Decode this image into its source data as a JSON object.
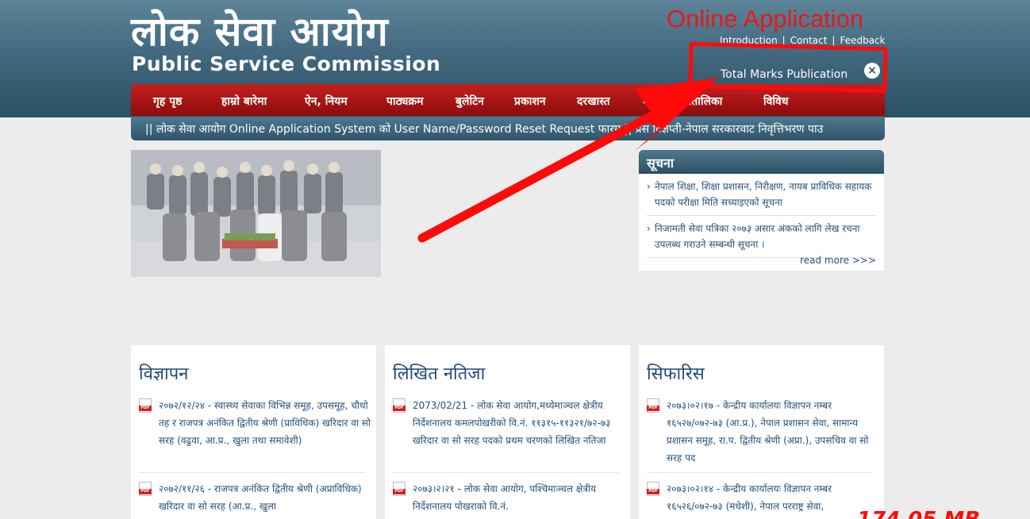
{
  "header": {
    "title_np": "लोक सेवा आयोग",
    "title_en": "Public Service Commission",
    "online_application": "Online Application",
    "links": [
      "Introduction",
      "Contact",
      "Feedback"
    ],
    "total_marks": "Total Marks Publication"
  },
  "nav": [
    "गृह पृष्ठ",
    "हाम्रो बारेमा",
    "ऐन, नियम",
    "पाठ्यक्रम",
    "बुलेटिन",
    "प्रकाशन",
    "दरखास्त",
    "वार्षिक कार्यतालिका",
    "विविध"
  ],
  "ticker": "|| लोक सेवा आयोग Online Application System को User Name/Password Reset Request फारम || प्रेस विज्ञप्ती-नेपाल सरकारवाट निवृत्तिभरण पाउ",
  "notice": {
    "title": "सूचना",
    "items": [
      "नेपाल शिक्षा, शिक्षा प्रशासन, निरीक्षण, नायब प्राविधिक सहायक पदको परीक्षा मिति सच्याइएको सूचना",
      "निजामती सेवा पत्रिका २०७३ असार अंकको लागि लेख रचना उपलब्ध गराउने सम्बन्धी सूचना ।"
    ],
    "read_more": "read more >>>"
  },
  "cards": [
    {
      "title": "विज्ञापन",
      "items": [
        "२०७२/१२/२४ - स्वास्थ्य सेवाका विभिन्न समूह, उपसमूह, चौथो तह र राजपत्र अनंकित द्वितीय श्रेणी (प्राविधिक) खरिदार वा सो सरह (वढुवा, आ.प्र., खुला तथा समावेशी)",
        "२०७२/११/२६ - राजपत्र अनंकित द्वितीय श्रेणी (अप्राविधिक) खरिदार वा सो सरह (आ.प्र., खुला"
      ]
    },
    {
      "title": "लिखित नतिजा",
      "items": [
        "2073/02/21 - लोक सेवा आयोग,मध्येमाञ्चल क्षेत्रीय निर्देशनालय कमलपोखरीको वि.नं. ११३१५-११३२१/७२-७३ खरिदार वा सो सरह पदको प्रथम चरणको लिखित नतिजा",
        "२०७३।२।२१ - लोक सेवा आयोग, पश्चिमाञ्चल क्षेत्रीय निर्देशनालय पोखराको वि.नं."
      ]
    },
    {
      "title": "सिफारिस",
      "items": [
        "२०७३।०२।१७ - केन्द्रीय कार्यालयः विज्ञापन नम्बर १६५२७/०७२-७३ (आ.प्र.), नेपाल प्रशासन सेवा, सामान्य प्रशासन समूह, रा.प. द्वितीय श्रेणी (अप्रा.), उपसचिव वा सो सरह पद",
        "२०७३।०२।१४ - केन्द्रीय कार्यालयः विज्ञापन नम्बर १६५२६/०७२-७३ (मधेशी), नेपाल परराष्ट्र सेवा,"
      ]
    }
  ],
  "annotation": {
    "size_text": "174.05 MB",
    "color": "#ff0a0a"
  }
}
